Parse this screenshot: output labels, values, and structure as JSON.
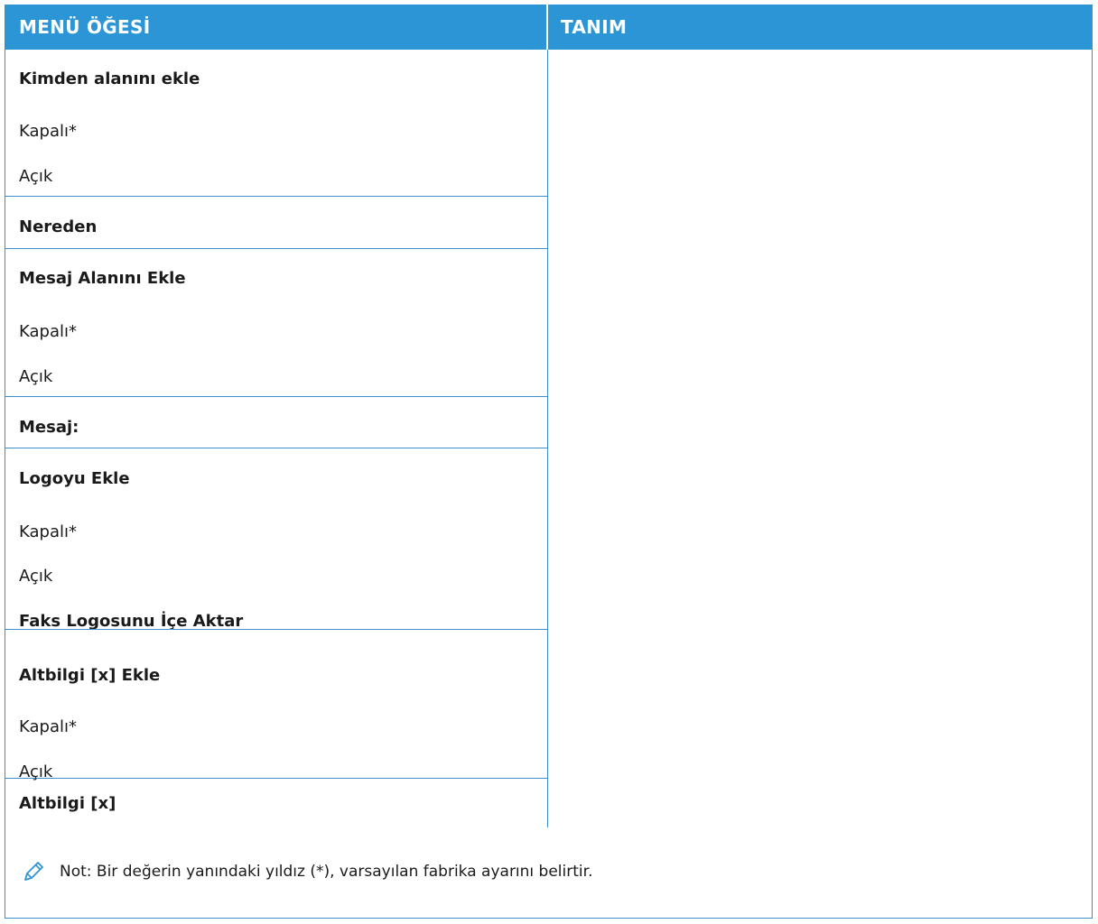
{
  "header": {
    "col1": "MENÜ ÖĞESİ",
    "col2": "TANIM"
  },
  "groups": [
    {
      "title": "Kimden alanını ekle",
      "options": [
        "Kapalı*",
        "Açık"
      ]
    },
    {
      "title": "Nereden",
      "options": []
    },
    {
      "title": "Mesaj Alanını Ekle",
      "options": [
        "Kapalı*",
        "Açık"
      ]
    },
    {
      "title": "Mesaj:",
      "options": []
    },
    {
      "title": "Logoyu Ekle",
      "options": [
        "Kapalı*",
        "Açık"
      ]
    },
    {
      "title": "Faks Logosunu İçe Aktar",
      "options": []
    },
    {
      "title": "Altbilgi [x] Ekle",
      "options": [
        "Kapalı*",
        "Açık"
      ]
    },
    {
      "title": "Altbilgi [x]",
      "options": []
    }
  ],
  "note": {
    "icon": "pencil-icon",
    "text": "Not: Bir değerin yanındaki yıldız (*), varsayılan fabrika ayarını belirtir."
  },
  "colors": {
    "header_bg": "#2b95d6",
    "border": "#3a8fd0",
    "text": "#1a1a1a"
  }
}
